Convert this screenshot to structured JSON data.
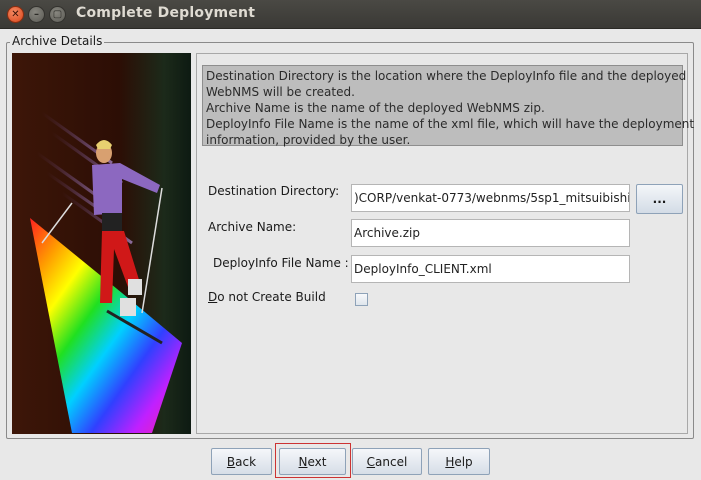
{
  "window": {
    "title": "Complete Deployment",
    "close_glyph": "✕",
    "min_glyph": "–",
    "max_glyph": "▢"
  },
  "group": {
    "legend": "Archive Details"
  },
  "info": {
    "lines": [
      "Destination Directory is the location where the DeployInfo file and the deployed",
      "WebNMS will be created.",
      "Archive Name is the name of the deployed WebNMS zip.",
      "DeployInfo File Name is the name of the xml file, which will have the deployment",
      "information, provided by the user."
    ]
  },
  "form": {
    "dest_label": "Destination Directory:",
    "dest_value": ")CORP/venkat-0773/webnms/5sp1_mitsuibishi",
    "browse_label": "...",
    "archive_label": "Archive Name:",
    "archive_value": "Archive.zip",
    "deployinfo_label": "DeployInfo File Name :",
    "deployinfo_value": "DeployInfo_CLIENT.xml",
    "nobuild_mnemonic": "D",
    "nobuild_rest": "o not Create Build",
    "nobuild_checked": false
  },
  "buttons": {
    "back_mnemonic": "B",
    "back_rest": "ack",
    "next_mnemonic": "N",
    "next_rest": "ext",
    "cancel_mnemonic": "C",
    "cancel_rest": "ancel",
    "help_mnemonic": "H",
    "help_rest": "elp"
  },
  "icons": [
    "window-close-icon",
    "window-minimize-icon",
    "window-maximize-icon",
    "skier-illustration"
  ]
}
